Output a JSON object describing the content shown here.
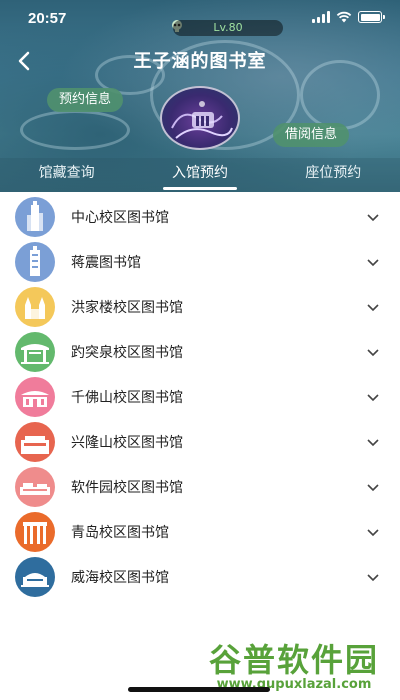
{
  "status": {
    "time": "20:57"
  },
  "header": {
    "level": "Lv.80",
    "title": "王子涵的图书室",
    "reserve_info": "预约信息",
    "borrow_info": "借阅信息",
    "bg_color": "#3f7890"
  },
  "tabs": [
    {
      "label": "馆藏查询"
    },
    {
      "label": "入馆预约"
    },
    {
      "label": "座位预约"
    }
  ],
  "libraries": [
    {
      "label": "中心校区图书馆",
      "color": "#7b9fd6"
    },
    {
      "label": "蒋震图书馆",
      "color": "#7b9fd6"
    },
    {
      "label": "洪家楼校区图书馆",
      "color": "#f4c85a"
    },
    {
      "label": "趵突泉校区图书馆",
      "color": "#63b96d"
    },
    {
      "label": "千佛山校区图书馆",
      "color": "#f07c9b"
    },
    {
      "label": "兴隆山校区图书馆",
      "color": "#e7654f"
    },
    {
      "label": "软件园校区图书馆",
      "color": "#ef8c8c"
    },
    {
      "label": "青岛校区图书馆",
      "color": "#ea6b2b"
    },
    {
      "label": "威海校区图书馆",
      "color": "#2f6d9e"
    }
  ],
  "watermark": {
    "brand": "谷普软件园",
    "url": "www.gupuxlazal.com"
  }
}
